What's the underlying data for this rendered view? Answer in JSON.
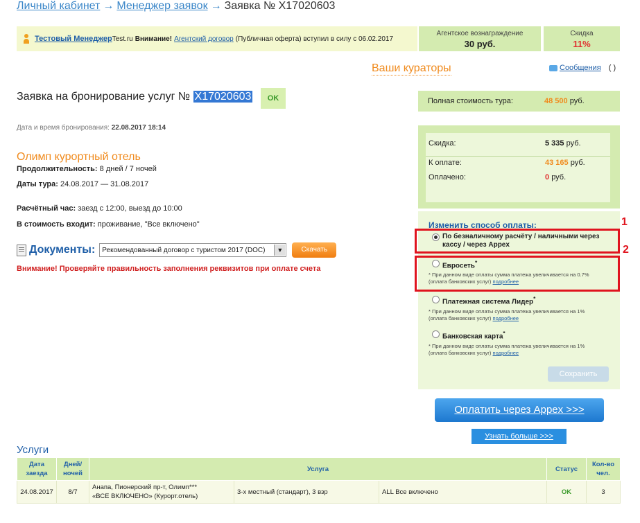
{
  "breadcrumb": {
    "items": [
      {
        "label": "Личный кабинет"
      },
      {
        "label": "Менеджер заявок"
      }
    ],
    "separator": "→",
    "current": "Заявка № X17020603"
  },
  "notice": {
    "manager_name": "Тестовый Менеджер",
    "agency": "Test.ru",
    "attention": "Внимание!",
    "contract_link": "Агентский договор",
    "tail": "(Публичная оферта) вступил в силу с 06.02.2017"
  },
  "reward": {
    "label": "Агентское вознаграждение",
    "value": "30 руб."
  },
  "discount": {
    "label": "Скидка",
    "value": "11%"
  },
  "curators": {
    "title": "Ваши кураторы"
  },
  "messages": {
    "label": "Сообщения",
    "count": "( )"
  },
  "order": {
    "title": "Заявка на бронирование услуг №",
    "number": "X17020603",
    "status": "OK",
    "booking_date_label": "Дата и время бронирования:",
    "booking_date": "22.08.2017 18:14"
  },
  "hotel": {
    "name": "Олимп курортный отель",
    "duration_label": "Продолжительность:",
    "duration": "8 дней / 7 ночей",
    "dates_label": "Даты тура:",
    "dates": "24.08.2017 — 31.08.2017",
    "checkin_label": "Расчётный час:",
    "checkin": "заезд с 12:00, выезд до 10:00",
    "includes_label": "В стоимость входит:",
    "includes": "проживание, \"Все включено\""
  },
  "documents": {
    "label": "Документы",
    "selected": "Рекомендованный договор с туристом 2017 (DOC)",
    "download": "Скачать"
  },
  "warning": "Внимание! Проверяйте правильность заполнения реквизитов при оплате счета",
  "full_cost": {
    "label": "Полная стоимость тура:",
    "amount": "48 500",
    "unit": "руб."
  },
  "summary": {
    "discount_label": "Скидка:",
    "discount_amount": "5 335",
    "to_pay_label": "К оплате:",
    "to_pay_amount": "43 165",
    "paid_label": "Оплачено:",
    "paid_amount": "0",
    "unit": "руб."
  },
  "payment": {
    "title": "Изменить способ оплаты:",
    "options": [
      {
        "label": "По безналичному расчёту / наличными через кассу / через Appex",
        "selected": true
      },
      {
        "label": "Евросеть",
        "note": "* При данном виде оплаты сумма платежа увеличивается на 0.7%",
        "note2": "(оплата банковских услуг)"
      },
      {
        "label": "Платежная система Лидер",
        "note": "* При данном виде оплаты сумма платежа увеличивается на 1%",
        "note2": "(оплата банковских услуг)"
      },
      {
        "label": "Банковская карта",
        "note": "* При данном виде оплаты сумма платежа увеличивается на 1%",
        "note2": "(оплата банковских услуг)"
      }
    ],
    "more": "подробнее",
    "save": "Сохранить",
    "markers": [
      "1",
      "2"
    ]
  },
  "pay_appex": "Оплатить через Appex >>>",
  "learn_more": "Узнать больше >>>",
  "services": {
    "title": "Услуги",
    "headers": [
      "Дата заезда",
      "Дней/ ночей",
      "Услуга",
      "Статус",
      "Кол-во чел."
    ],
    "rows": [
      {
        "date": "24.08.2017",
        "nights": "8/7",
        "hotel": "Анапа, Пионерский пр-т, Олимп***",
        "hotel2": "«ВСЕ ВКЛЮЧЕНО» (Курорт.отель)",
        "room": "3-х местный (стандарт), 3 взр",
        "meal": "ALL Все включено",
        "status": "OK",
        "people": "3"
      }
    ]
  },
  "colors": {
    "accent": "#f08a1c",
    "link": "#1f5fa8",
    "panel": "#d4ebb0",
    "alert": "#e0141e"
  }
}
